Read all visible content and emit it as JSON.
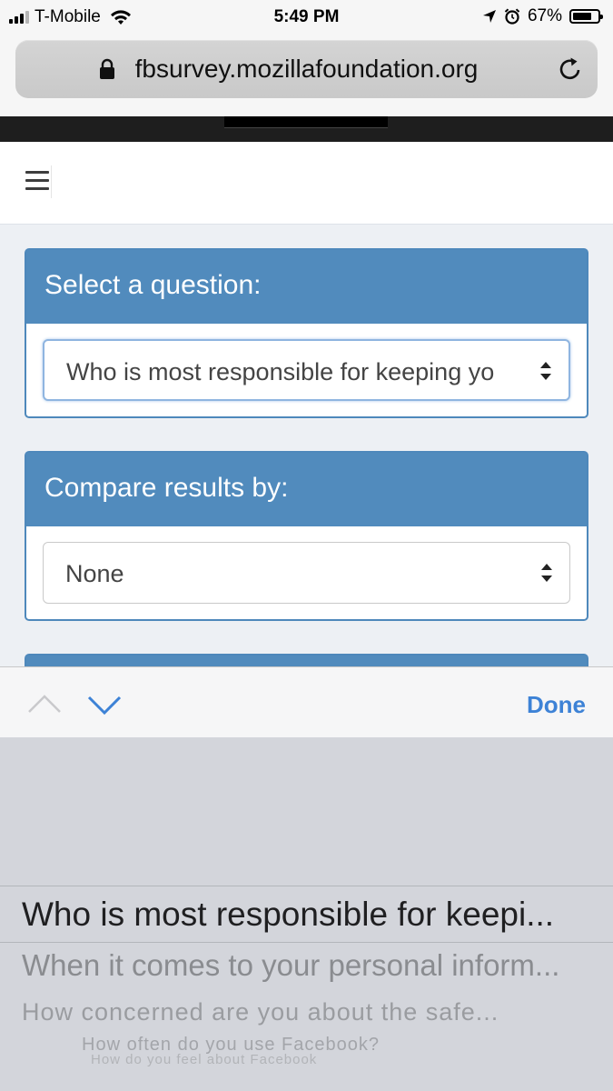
{
  "status_bar": {
    "carrier": "T-Mobile",
    "time": "5:49 PM",
    "battery": "67%",
    "battery_level": 0.67,
    "signal_bars": 3
  },
  "browser": {
    "url": "fbsurvey.mozillafoundation.org"
  },
  "page": {
    "question_card": {
      "heading": "Select a question:",
      "selected_value": "Who is most responsible for keeping yo"
    },
    "compare_card": {
      "heading": "Compare results by:",
      "selected_value": "None"
    }
  },
  "accessory_bar": {
    "done_label": "Done"
  },
  "picker": {
    "selected": "Who is most responsible for keepi...",
    "options": [
      "When it comes to your personal inform...",
      "How concerned are you about the safe...",
      "How often do you use Facebook?",
      "How do you feel about Facebook"
    ]
  },
  "colors": {
    "card_header": "#518bbd",
    "accent": "#3d82d6"
  }
}
